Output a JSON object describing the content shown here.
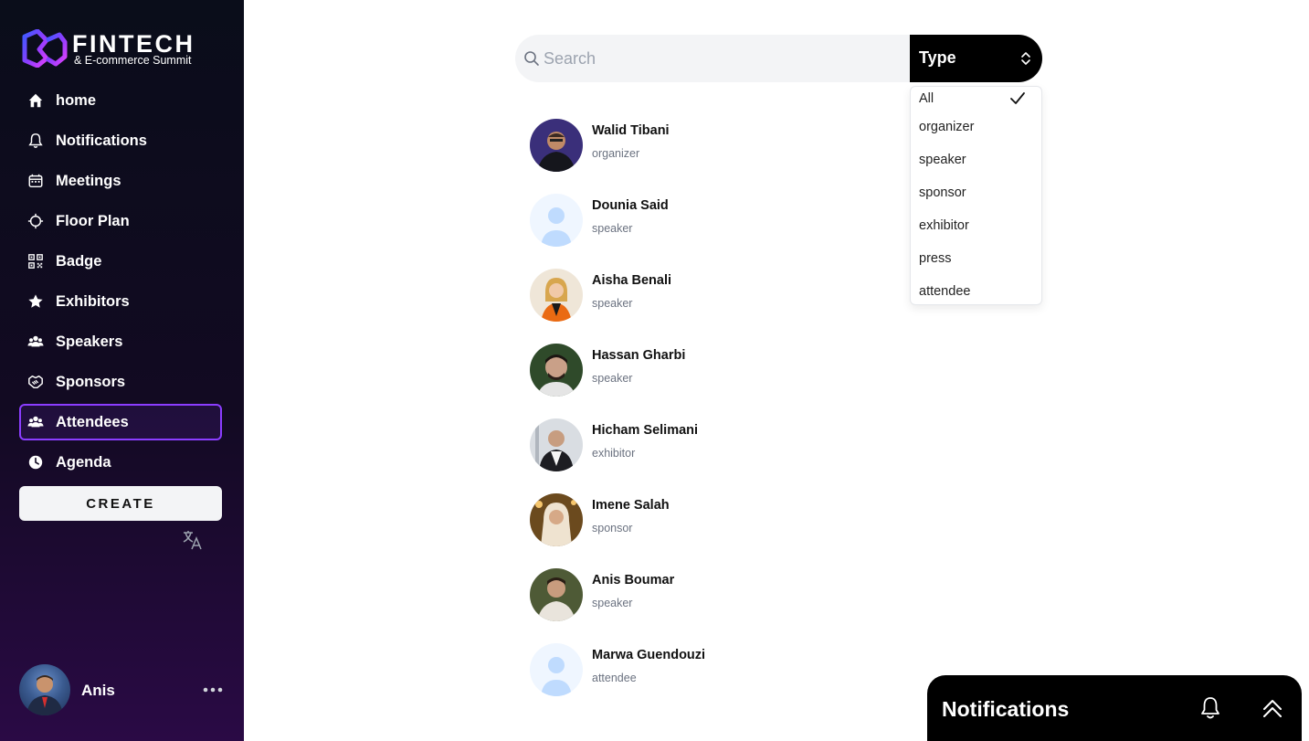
{
  "brand": {
    "title": "FINTECH",
    "subtitle": "& E-commerce Summit",
    "accent_colors": [
      "#8b3dff",
      "#e040fb",
      "#3b5bff"
    ]
  },
  "sidebar": {
    "items": [
      {
        "label": "home",
        "icon": "home-icon"
      },
      {
        "label": "Notifications",
        "icon": "bell-icon"
      },
      {
        "label": "Meetings",
        "icon": "calendar-icon"
      },
      {
        "label": "Floor Plan",
        "icon": "crosshair-icon"
      },
      {
        "label": "Badge",
        "icon": "qr-code-icon"
      },
      {
        "label": "Exhibitors",
        "icon": "star-icon"
      },
      {
        "label": "Speakers",
        "icon": "users-icon"
      },
      {
        "label": "Sponsors",
        "icon": "handshake-icon"
      },
      {
        "label": "Attendees",
        "icon": "users-icon",
        "active": true
      },
      {
        "label": "Agenda",
        "icon": "clock-icon"
      }
    ],
    "create_label": "CREATE",
    "active_color": "#8b3dff"
  },
  "user": {
    "name": "Anis"
  },
  "search": {
    "placeholder": "Search",
    "value": ""
  },
  "type_filter": {
    "label": "Type",
    "options": [
      "All",
      "organizer",
      "speaker",
      "sponsor",
      "exhibitor",
      "press",
      "attendee"
    ],
    "selected": "All"
  },
  "people": [
    {
      "name": "Walid Tibani",
      "role": "organizer",
      "avatar": "photo"
    },
    {
      "name": "Dounia Said",
      "role": "speaker",
      "avatar": "placeholder"
    },
    {
      "name": "Aisha Benali",
      "role": "speaker",
      "avatar": "photo"
    },
    {
      "name": "Hassan Gharbi",
      "role": "speaker",
      "avatar": "photo"
    },
    {
      "name": "Hicham Selimani",
      "role": "exhibitor",
      "avatar": "photo"
    },
    {
      "name": "Imene Salah",
      "role": "sponsor",
      "avatar": "photo"
    },
    {
      "name": "Anis Boumar",
      "role": "speaker",
      "avatar": "photo"
    },
    {
      "name": "Marwa Guendouzi",
      "role": "attendee",
      "avatar": "placeholder"
    }
  ],
  "notifications_panel": {
    "title": "Notifications"
  }
}
